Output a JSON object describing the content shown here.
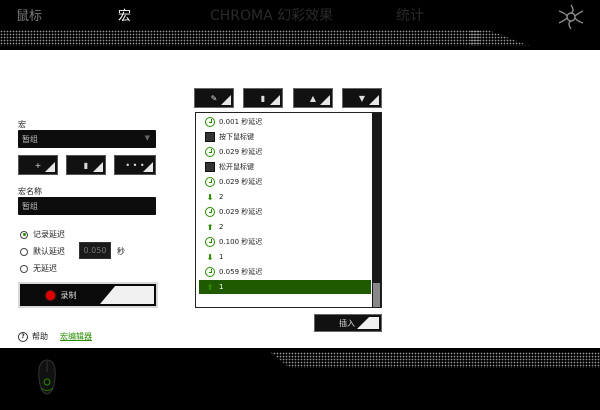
{
  "nav": {
    "tabs": [
      {
        "label": "鼠标"
      },
      {
        "label": "宏"
      },
      {
        "label": "CHROMA 幻彩效果"
      },
      {
        "label": "统计"
      }
    ]
  },
  "left": {
    "macro_label": "宏",
    "macro_value": "暂组",
    "add_button": "+",
    "delete_button": "▮",
    "more_button": "• • •",
    "name_label": "宏名称",
    "name_value": "暂组",
    "delay_options": [
      {
        "label": "记录延迟",
        "selected": true
      },
      {
        "label": "默认延迟",
        "selected": false
      },
      {
        "label": "无延迟",
        "selected": false
      }
    ],
    "delay_value": "0.050",
    "delay_unit": "秒",
    "record_label": "录制",
    "help_label": "帮助",
    "help_link": "宏编辑器"
  },
  "toolbar": {
    "edit_button": "✎",
    "delete_button": "▮",
    "up_button": "▲",
    "down_button": "▼"
  },
  "list": {
    "items": [
      {
        "icon": "clock-icon",
        "text": "0.001 秒延迟"
      },
      {
        "icon": "mouse-icon",
        "text": "按下鼠标键"
      },
      {
        "icon": "clock-icon",
        "text": "0.029 秒延迟"
      },
      {
        "icon": "mouse-icon",
        "text": "松开鼠标键"
      },
      {
        "icon": "clock-icon",
        "text": "0.029 秒延迟"
      },
      {
        "icon": "arrow-down-icon",
        "text": "2"
      },
      {
        "icon": "clock-icon",
        "text": "0.029 秒延迟"
      },
      {
        "icon": "arrow-up-icon",
        "text": "2"
      },
      {
        "icon": "clock-icon",
        "text": "0.100 秒延迟"
      },
      {
        "icon": "arrow-down-icon",
        "text": "1"
      },
      {
        "icon": "clock-icon",
        "text": "0.059 秒延迟"
      },
      {
        "icon": "arrow-up-icon",
        "text": "1"
      }
    ],
    "selected_index": 11
  },
  "insert_button": "插入",
  "colors": {
    "accent": "#2a8c00",
    "selected_row": "#1f5a00",
    "record": "#e00000"
  }
}
